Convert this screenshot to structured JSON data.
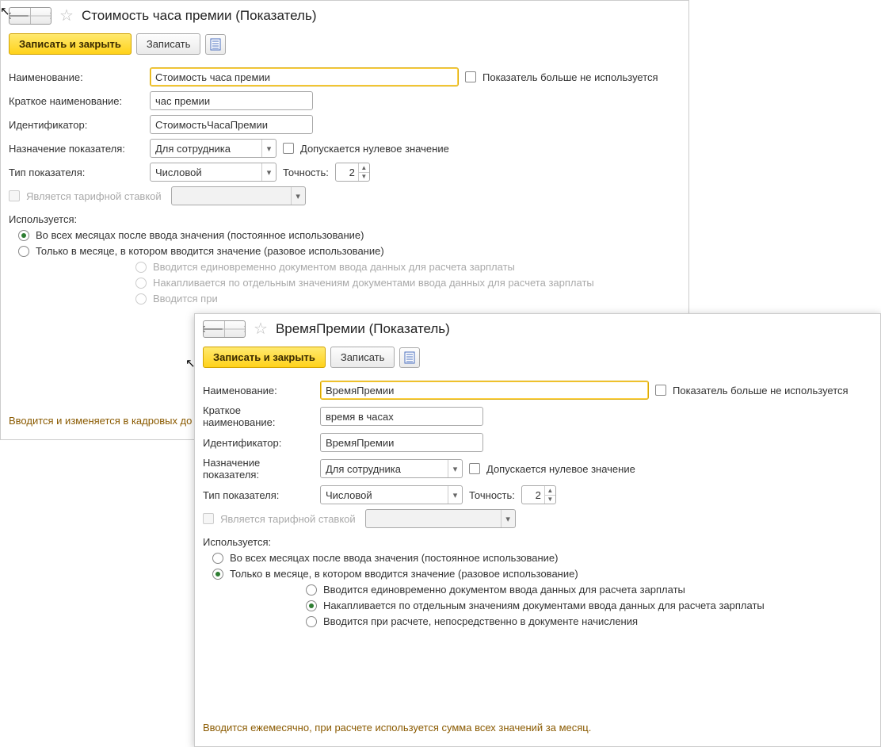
{
  "common": {
    "save_and_close": "Записать и закрыть",
    "save": "Записать",
    "name_label": "Наименование:",
    "short_name_label": "Краткое наименование:",
    "identifier_label": "Идентификатор:",
    "purpose_label": "Назначение показателя:",
    "purpose_value": "Для сотрудника",
    "allow_zero": "Допускается нулевое значение",
    "type_label": "Тип показателя:",
    "type_value": "Числовой",
    "precision_label": "Точность:",
    "precision_value": "2",
    "is_rate": "Является тарифной ставкой",
    "used_label": "Используется:",
    "opt1": "Во всех месяцах после ввода значения (постоянное использование)",
    "opt2": "Только в месяце, в котором вводится значение (разовое использование)",
    "sub1": "Вводится единовременно документом ввода данных для расчета зарплаты",
    "sub2": "Накапливается по отдельным значениям документами ввода данных для расчета зарплаты",
    "sub3_trunc": "Вводится при",
    "sub3": "Вводится при расчете, непосредственно в документе начисления",
    "not_used": "Показатель больше не используется"
  },
  "win1": {
    "title": "Стоимость часа премии (Показатель)",
    "name": "Стоимость часа премии",
    "short_name": "час премии",
    "identifier": "СтоимостьЧасаПремии",
    "bottom_note": "Вводится и изменяется в кадровых до"
  },
  "win2": {
    "title": "ВремяПремии (Показатель)",
    "name": "ВремяПремии",
    "short_name": "время в часах",
    "identifier": "ВремяПремии",
    "bottom_note": "Вводится ежемесячно, при расчете используется сумма всех значений за месяц."
  }
}
